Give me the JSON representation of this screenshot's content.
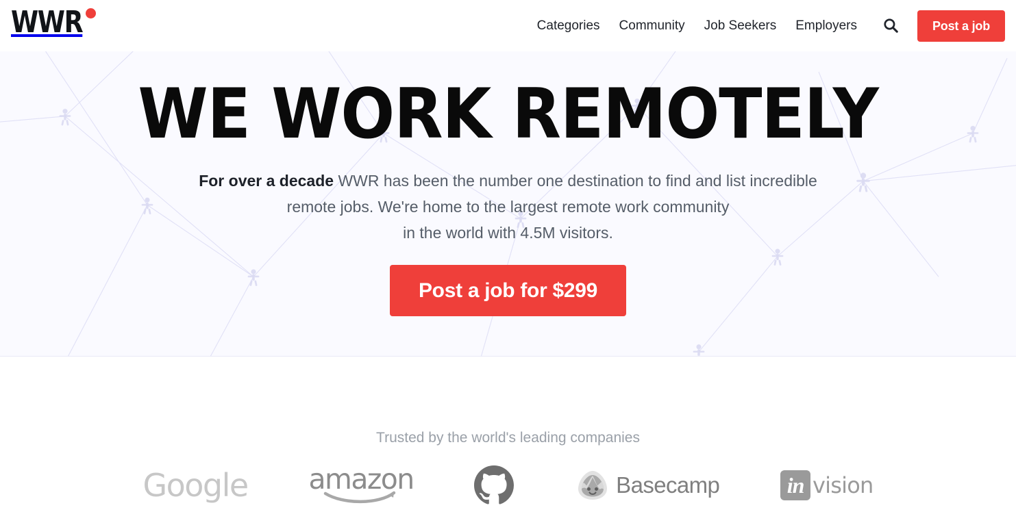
{
  "header": {
    "brand": {
      "text": "WWR",
      "dot_color": "#ef3f3a",
      "dot_name": "red-dot"
    },
    "nav": [
      {
        "label": "Categories"
      },
      {
        "label": "Community"
      },
      {
        "label": "Job Seekers"
      },
      {
        "label": "Employers"
      }
    ],
    "search_icon": "search-icon",
    "post_job_label": "Post a job",
    "accent_color": "#ef3f3a"
  },
  "hero": {
    "title": "WE WORK REMOTELY",
    "subtitle_lead": "For over a decade",
    "subtitle_rest": " WWR has been the number one destination to find and list incredible",
    "subtitle_line2": "remote jobs. We're home to the largest remote work community",
    "subtitle_line3": "in the world with 4.5M visitors.",
    "cta_label": "Post a job for $299",
    "background_color": "#fafaff",
    "pattern": "network-of-people-nodes"
  },
  "trusted": {
    "label": "Trusted by the world's leading companies",
    "logos": [
      {
        "name": "google",
        "text": "Google"
      },
      {
        "name": "amazon",
        "text": "amazon"
      },
      {
        "name": "github",
        "text": ""
      },
      {
        "name": "basecamp",
        "text": "Basecamp"
      },
      {
        "name": "invision",
        "text_mark": "in",
        "text": "vision"
      }
    ]
  }
}
